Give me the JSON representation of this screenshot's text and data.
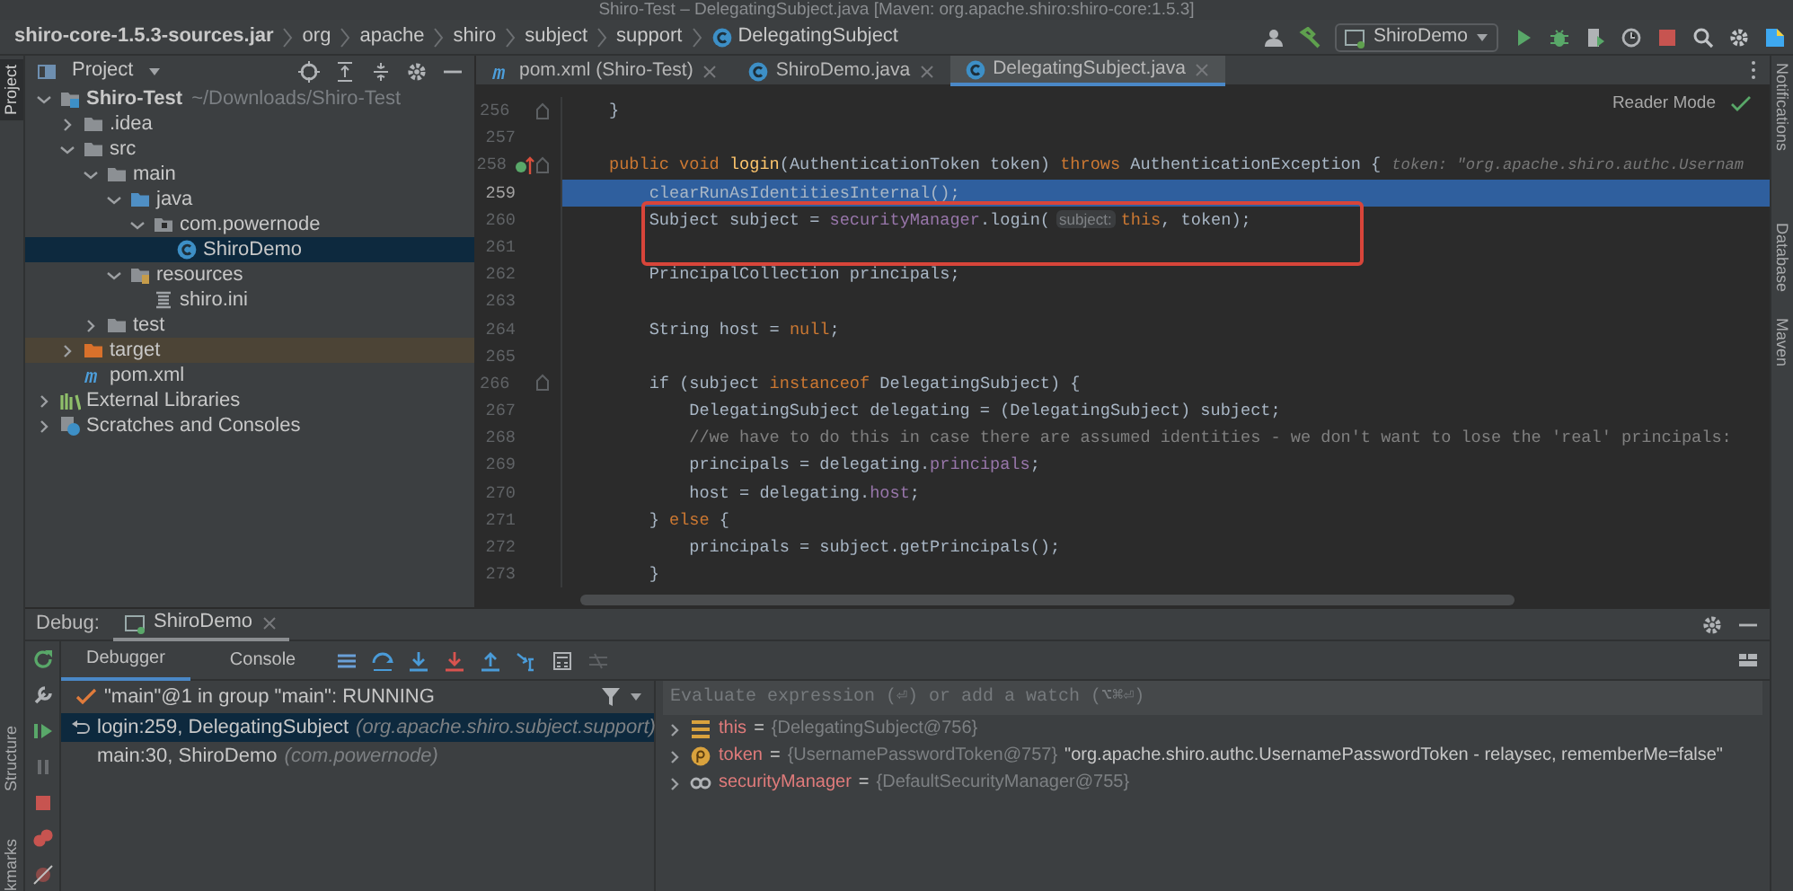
{
  "window": {
    "title": "Shiro-Test – DelegatingSubject.java [Maven: org.apache.shiro:shiro-core:1.5.3]"
  },
  "breadcrumbs": [
    {
      "label": "shiro-core-1.5.3-sources.jar",
      "kind": "jar"
    },
    {
      "label": "org",
      "kind": "package"
    },
    {
      "label": "apache",
      "kind": "package"
    },
    {
      "label": "shiro",
      "kind": "package"
    },
    {
      "label": "subject",
      "kind": "package"
    },
    {
      "label": "support",
      "kind": "package"
    },
    {
      "label": "DelegatingSubject",
      "kind": "class"
    }
  ],
  "toolbar": {
    "run_configuration": "ShiroDemo"
  },
  "side_stripes": {
    "left": [
      {
        "label": "Project",
        "selected": true
      },
      {
        "label": "Structure",
        "selected": false
      },
      {
        "label": "kmarks",
        "selected": false
      }
    ],
    "right": [
      {
        "label": "Notifications"
      },
      {
        "label": "Database"
      },
      {
        "label": "Maven"
      }
    ]
  },
  "project_panel": {
    "title": "Project",
    "tree": [
      {
        "label": "Shiro-Test",
        "kind": "module",
        "hint": "~/Downloads/Shiro-Test",
        "expanded": true,
        "selected": false,
        "children": [
          {
            "label": ".idea",
            "kind": "folder",
            "expanded": false,
            "selected": false
          },
          {
            "label": "src",
            "kind": "folder",
            "expanded": true,
            "selected": false,
            "children": [
              {
                "label": "main",
                "kind": "folder",
                "expanded": true,
                "selected": false,
                "children": [
                  {
                    "label": "java",
                    "kind": "source",
                    "expanded": true,
                    "selected": false,
                    "children": [
                      {
                        "label": "com.powernode",
                        "kind": "package",
                        "expanded": true,
                        "selected": false,
                        "children": [
                          {
                            "label": "ShiroDemo",
                            "kind": "class",
                            "selected": true
                          }
                        ]
                      }
                    ]
                  },
                  {
                    "label": "resources",
                    "kind": "resources",
                    "expanded": true,
                    "selected": false,
                    "children": [
                      {
                        "label": "shiro.ini",
                        "kind": "ini",
                        "selected": false
                      }
                    ]
                  }
                ]
              },
              {
                "label": "test",
                "kind": "folder",
                "expanded": false,
                "selected": false
              }
            ]
          },
          {
            "label": "target",
            "kind": "excluded",
            "expanded": false,
            "selected": false
          },
          {
            "label": "pom.xml",
            "kind": "maven",
            "selected": false
          }
        ]
      },
      {
        "label": "External Libraries",
        "kind": "libraries",
        "expanded": false,
        "selected": false
      },
      {
        "label": "Scratches and Consoles",
        "kind": "scratches",
        "expanded": false,
        "selected": false
      }
    ]
  },
  "editor_tabs": [
    {
      "label": "pom.xml (Shiro-Test)",
      "kind": "maven",
      "selected": false
    },
    {
      "label": "ShiroDemo.java",
      "kind": "class",
      "selected": false
    },
    {
      "label": "DelegatingSubject.java",
      "kind": "class",
      "selected": true
    }
  ],
  "editor": {
    "reader_mode": "Reader Mode",
    "lines": [
      {
        "number": "256",
        "selected": false,
        "boxed": false,
        "override": false,
        "fold": true,
        "tokens": [
          {
            "kind": "plain",
            "text": "}"
          }
        ]
      },
      {
        "number": "257",
        "selected": false,
        "boxed": false,
        "override": false,
        "fold": false
      },
      {
        "number": "258",
        "selected": false,
        "boxed": false,
        "override": true,
        "fold": true,
        "tokens": [
          {
            "kind": "kw",
            "text": "public void "
          },
          {
            "kind": "decl",
            "text": "login"
          },
          {
            "kind": "plain",
            "text": "(AuthenticationToken token) "
          },
          {
            "kind": "kw",
            "text": "throws "
          },
          {
            "kind": "plain",
            "text": "AuthenticationException {"
          },
          {
            "kind": "value",
            "text": "token: \"org.apache.shiro.authc.Usernam"
          }
        ]
      },
      {
        "number": "259",
        "selected": true,
        "boxed": false,
        "override": false,
        "fold": false,
        "tokens": [
          {
            "kind": "plain",
            "text": "    clearRunAsIdentitiesInternal();"
          }
        ]
      },
      {
        "number": "260",
        "selected": false,
        "boxed": true,
        "override": false,
        "fold": false,
        "tokens": [
          {
            "kind": "plain",
            "text": "    Subject subject = "
          },
          {
            "kind": "field",
            "text": "securityManager"
          },
          {
            "kind": "plain",
            "text": ".login("
          },
          {
            "kind": "hint",
            "text": "subject:"
          },
          {
            "kind": "kw",
            "text": "this"
          },
          {
            "kind": "plain",
            "text": ", token);"
          }
        ]
      },
      {
        "number": "261",
        "selected": false,
        "boxed": true,
        "override": false,
        "fold": false
      },
      {
        "number": "262",
        "selected": false,
        "boxed": false,
        "override": false,
        "fold": false,
        "tokens": [
          {
            "kind": "plain",
            "text": "    PrincipalCollection principals;"
          }
        ]
      },
      {
        "number": "263",
        "selected": false,
        "boxed": false,
        "override": false,
        "fold": false
      },
      {
        "number": "264",
        "selected": false,
        "boxed": false,
        "override": false,
        "fold": false,
        "tokens": [
          {
            "kind": "plain",
            "text": "    String host = "
          },
          {
            "kind": "kw",
            "text": "null"
          },
          {
            "kind": "plain",
            "text": ";"
          }
        ]
      },
      {
        "number": "265",
        "selected": false,
        "boxed": false,
        "override": false,
        "fold": false
      },
      {
        "number": "266",
        "selected": false,
        "boxed": false,
        "override": false,
        "fold": true,
        "tokens": [
          {
            "kind": "plain",
            "text": "    if (subject "
          },
          {
            "kind": "kw",
            "text": "instanceof "
          },
          {
            "kind": "plain",
            "text": "DelegatingSubject) {"
          }
        ]
      },
      {
        "number": "267",
        "selected": false,
        "boxed": false,
        "override": false,
        "fold": false,
        "tokens": [
          {
            "kind": "plain",
            "text": "        DelegatingSubject delegating = (DelegatingSubject) subject;"
          }
        ]
      },
      {
        "number": "268",
        "selected": false,
        "boxed": false,
        "override": false,
        "fold": false,
        "tokens": [
          {
            "kind": "comment",
            "text": "        //we have to do this in case there are assumed identities - we don't want to lose the 'real' principals:"
          }
        ]
      },
      {
        "number": "269",
        "selected": false,
        "boxed": false,
        "override": false,
        "fold": false,
        "tokens": [
          {
            "kind": "plain",
            "text": "        principals = delegating."
          },
          {
            "kind": "field",
            "text": "principals"
          },
          {
            "kind": "plain",
            "text": ";"
          }
        ]
      },
      {
        "number": "270",
        "selected": false,
        "boxed": false,
        "override": false,
        "fold": false,
        "tokens": [
          {
            "kind": "plain",
            "text": "        host = delegating."
          },
          {
            "kind": "field",
            "text": "host"
          },
          {
            "kind": "plain",
            "text": ";"
          }
        ]
      },
      {
        "number": "271",
        "selected": false,
        "boxed": false,
        "override": false,
        "fold": false,
        "tokens": [
          {
            "kind": "plain",
            "text": "    } "
          },
          {
            "kind": "kw",
            "text": "else "
          },
          {
            "kind": "plain",
            "text": "{"
          }
        ]
      },
      {
        "number": "272",
        "selected": false,
        "boxed": false,
        "override": false,
        "fold": false,
        "tokens": [
          {
            "kind": "plain",
            "text": "        principals = subject.getPrincipals();"
          }
        ]
      },
      {
        "number": "273",
        "selected": false,
        "boxed": false,
        "override": false,
        "fold": false,
        "tokens": [
          {
            "kind": "plain",
            "text": "    }"
          }
        ]
      }
    ]
  },
  "debug": {
    "label": "Debug:",
    "session_tab": "ShiroDemo",
    "tabs": [
      {
        "label": "Debugger",
        "selected": true
      },
      {
        "label": "Console",
        "selected": false
      }
    ],
    "thread": "\"main\"@1 in group \"main\": RUNNING",
    "frames": [
      {
        "method": "login:259, DelegatingSubject",
        "package": "(org.apache.shiro.subject.support)",
        "selected": true
      },
      {
        "method": "main:30, ShiroDemo",
        "package": "(com.powernode)",
        "selected": false
      }
    ],
    "watch_placeholder": "Evaluate expression (⏎) or add a watch (⌥⌘⏎)",
    "variables": [
      {
        "kind": "object",
        "name": "this",
        "operator": "=",
        "type": "{DelegatingSubject@756}"
      },
      {
        "kind": "param",
        "name": "token",
        "operator": "=",
        "type": "{UsernamePasswordToken@757}",
        "value": "\"org.apache.shiro.authc.UsernamePasswordToken - relaysec, rememberMe=false\""
      },
      {
        "kind": "field",
        "name": "securityManager",
        "operator": "=",
        "type": "{DefaultSecurityManager@755}"
      }
    ]
  }
}
